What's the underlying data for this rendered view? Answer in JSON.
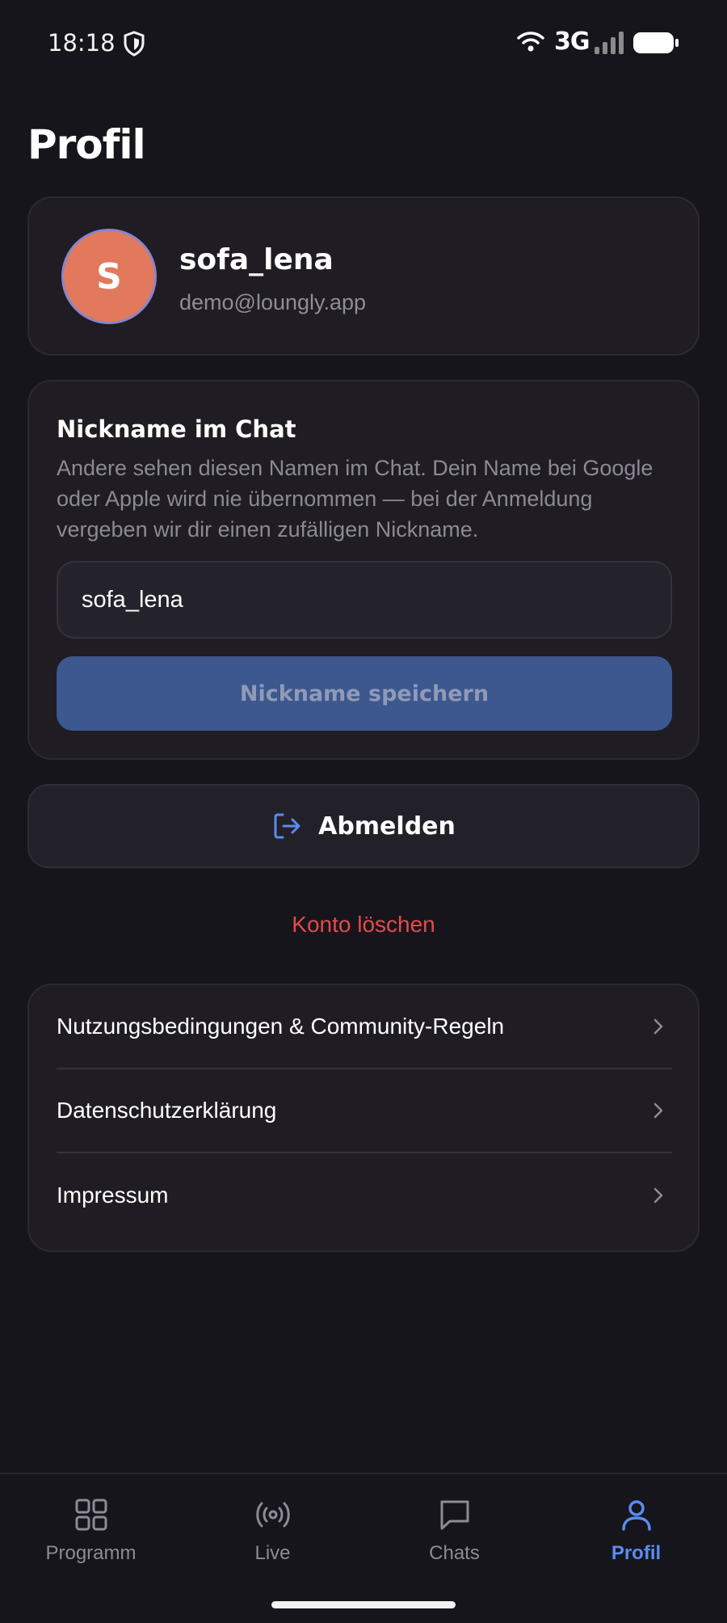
{
  "status_bar": {
    "time": "18:18",
    "network": "3G",
    "icons": [
      "shield-icon",
      "wifi-icon",
      "signal-icon",
      "battery-icon"
    ]
  },
  "page": {
    "title": "Profil"
  },
  "profile": {
    "avatar_initial": "S",
    "avatar_color": "#e2795d",
    "name": "sofa_lena",
    "email": "demo@loungly.app"
  },
  "nickname": {
    "title": "Nickname im Chat",
    "description": "Andere sehen diesen Namen im Chat. Dein Name bei Google oder Apple wird nie übernommen — bei der Anmeldung vergeben wir dir einen zufälligen Nickname.",
    "value": "sofa_lena",
    "save_label": "Nickname speichern"
  },
  "logout": {
    "label": "Abmelden",
    "icon": "logout-icon"
  },
  "delete_account": {
    "label": "Konto löschen",
    "color": "#e24b4b"
  },
  "links": [
    {
      "label": "Nutzungsbedingungen & Community-Regeln"
    },
    {
      "label": "Datenschutzerklärung"
    },
    {
      "label": "Impressum"
    }
  ],
  "bottom_nav": {
    "items": [
      {
        "label": "Programm",
        "icon": "grid-icon"
      },
      {
        "label": "Live",
        "icon": "broadcast-icon"
      },
      {
        "label": "Chats",
        "icon": "chat-bubble-icon"
      },
      {
        "label": "Profil",
        "icon": "user-icon",
        "active": true
      }
    ],
    "accent": "#5b8bf0"
  }
}
